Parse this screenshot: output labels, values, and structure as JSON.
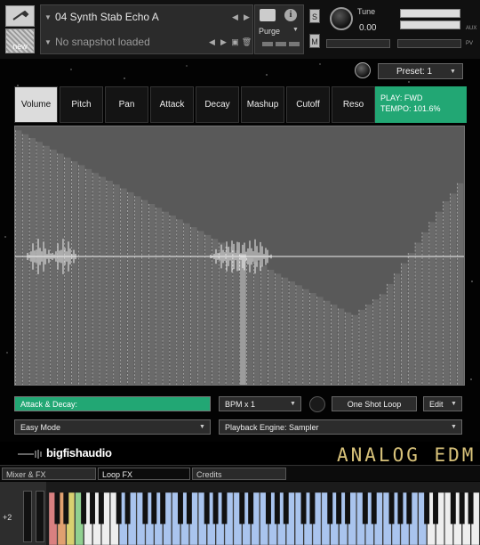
{
  "header": {
    "tool_icon": "wrench-icon",
    "new_label": "new",
    "instrument_name": "04 Synth Stab Echo A",
    "snapshot_text": "No snapshot loaded",
    "purge_label": "Purge",
    "solo_label": "S",
    "mute_label": "M",
    "tune_label": "Tune",
    "tune_value": "0.00",
    "aux_label": "AUX",
    "pv_label": "PV"
  },
  "preset": {
    "label": "Preset: 1"
  },
  "tabs": [
    {
      "label": "Volume",
      "active": true
    },
    {
      "label": "Pitch",
      "active": false
    },
    {
      "label": "Pan",
      "active": false
    },
    {
      "label": "Attack",
      "active": false
    },
    {
      "label": "Decay",
      "active": false
    },
    {
      "label": "Mashup",
      "active": false
    },
    {
      "label": "Cutoff",
      "active": false
    },
    {
      "label": "Reso",
      "active": false
    }
  ],
  "play_info": {
    "mode": "PLAY: FWD",
    "tempo": "TEMPO: 101.6%"
  },
  "step_grid": {
    "step_count": 64,
    "highlight_step": 32,
    "levels": [
      0.985,
      0.97,
      0.955,
      0.94,
      0.925,
      0.91,
      0.895,
      0.88,
      0.865,
      0.85,
      0.835,
      0.82,
      0.805,
      0.79,
      0.775,
      0.76,
      0.745,
      0.73,
      0.715,
      0.7,
      0.685,
      0.67,
      0.655,
      0.64,
      0.625,
      0.61,
      0.595,
      0.58,
      0.565,
      0.55,
      0.535,
      0.52,
      0.505,
      0.49,
      0.475,
      0.46,
      0.445,
      0.43,
      0.415,
      0.4,
      0.385,
      0.37,
      0.355,
      0.34,
      0.325,
      0.31,
      0.295,
      0.28,
      0.27,
      0.29,
      0.31,
      0.33,
      0.35,
      0.39,
      0.43,
      0.47,
      0.51,
      0.55,
      0.59,
      0.63,
      0.67,
      0.71,
      0.74,
      0.78
    ]
  },
  "controls": {
    "attack_decay_label": "Attack & Decay:",
    "bpm_label": "BPM x 1",
    "one_shot_label": "One Shot Loop",
    "edit_label": "Edit",
    "mode_label": "Easy Mode",
    "engine_label": "Playback Engine: Sampler"
  },
  "footer": {
    "logo_text": "bigfishaudio",
    "brand_text": "ANALOG EDM",
    "tabs": [
      "Mixer & FX",
      "Loop FX",
      "Credits"
    ],
    "active_tab": "Loop FX"
  },
  "keyboard": {
    "octave_label": "+2"
  },
  "colors": {
    "accent_green": "#22a774",
    "brand_gold": "#d8c27a"
  }
}
